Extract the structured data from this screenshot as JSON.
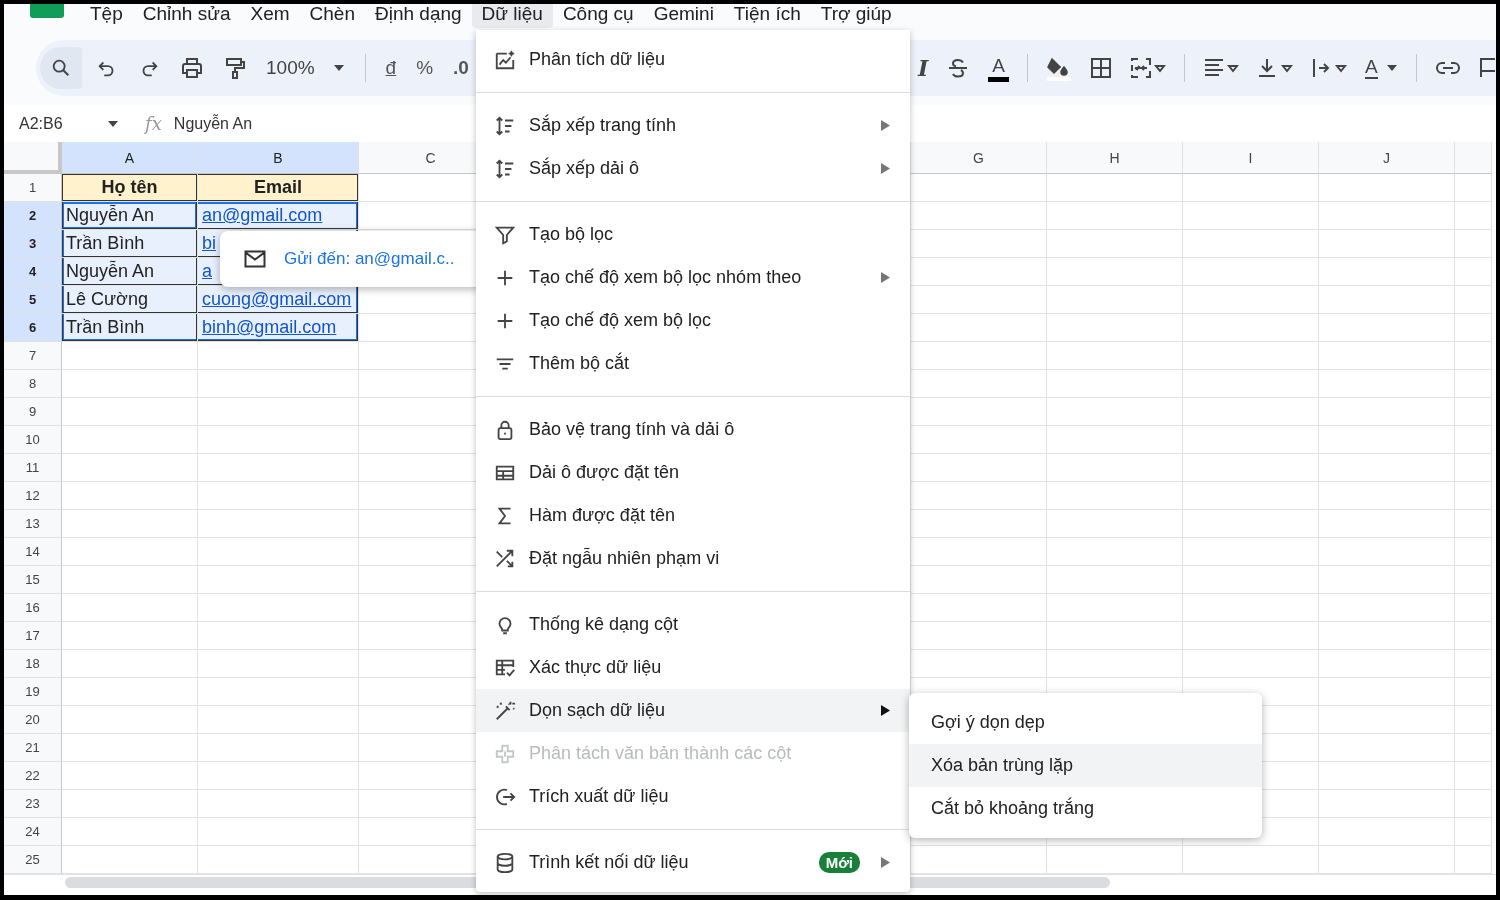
{
  "menu_bar": {
    "items": [
      {
        "label": "Tệp",
        "selected": false
      },
      {
        "label": "Chỉnh sửa",
        "selected": false
      },
      {
        "label": "Xem",
        "selected": false
      },
      {
        "label": "Chèn",
        "selected": false
      },
      {
        "label": "Định dạng",
        "selected": false
      },
      {
        "label": "Dữ liệu",
        "selected": true
      },
      {
        "label": "Công cụ",
        "selected": false
      },
      {
        "label": "Gemini",
        "selected": false
      },
      {
        "label": "Tiện ích",
        "selected": false
      },
      {
        "label": "Trợ giúp",
        "selected": false
      }
    ]
  },
  "toolbar": {
    "zoom": "100%",
    "currency": "đ",
    "percent": "%",
    "decimal": ".0",
    "italic": "I",
    "text_color": "A",
    "text_rotation": "A"
  },
  "formula_bar": {
    "name_box": "A2:B6",
    "fx": "fx",
    "value": "Nguyễn An"
  },
  "sheet": {
    "columns": [
      {
        "label": "A",
        "selected": true
      },
      {
        "label": "B",
        "selected": true
      },
      {
        "label": "C",
        "selected": false
      },
      {
        "label": "G",
        "selected": false
      },
      {
        "label": "H",
        "selected": false
      },
      {
        "label": "I",
        "selected": false
      },
      {
        "label": "J",
        "selected": false
      }
    ],
    "rows": [
      {
        "number": "1",
        "selected": false,
        "kind": "header",
        "cells": [
          {
            "text": "Họ tên",
            "link": false,
            "active": false
          },
          {
            "text": "Email",
            "link": false,
            "active": false
          }
        ]
      },
      {
        "number": "2",
        "selected": true,
        "kind": "data",
        "cells": [
          {
            "text": "Nguyễn An",
            "link": false,
            "active": true
          },
          {
            "text": "an@gmail.com",
            "link": true,
            "active": false
          }
        ]
      },
      {
        "number": "3",
        "selected": true,
        "kind": "data",
        "cells": [
          {
            "text": "Trần Bình",
            "link": false,
            "active": false
          },
          {
            "text": "bi",
            "link": true,
            "active": false
          }
        ]
      },
      {
        "number": "4",
        "selected": true,
        "kind": "data",
        "cells": [
          {
            "text": "Nguyễn An",
            "link": false,
            "active": false
          },
          {
            "text": "a",
            "link": true,
            "active": false
          }
        ]
      },
      {
        "number": "5",
        "selected": true,
        "kind": "data",
        "cells": [
          {
            "text": "Lê Cường",
            "link": false,
            "active": false
          },
          {
            "text": "cuong@gmail.com",
            "link": true,
            "active": false
          }
        ]
      },
      {
        "number": "6",
        "selected": true,
        "kind": "data",
        "cells": [
          {
            "text": "Trần Bình",
            "link": false,
            "active": false
          },
          {
            "text": "binh@gmail.com",
            "link": true,
            "active": false
          }
        ]
      },
      {
        "number": "7",
        "selected": false
      },
      {
        "number": "8",
        "selected": false
      },
      {
        "number": "9",
        "selected": false
      },
      {
        "number": "10",
        "selected": false
      },
      {
        "number": "11",
        "selected": false
      },
      {
        "number": "12",
        "selected": false
      },
      {
        "number": "13",
        "selected": false
      },
      {
        "number": "14",
        "selected": false
      },
      {
        "number": "15",
        "selected": false
      },
      {
        "number": "16",
        "selected": false
      },
      {
        "number": "17",
        "selected": false
      },
      {
        "number": "18",
        "selected": false
      },
      {
        "number": "19",
        "selected": false
      },
      {
        "number": "20",
        "selected": false
      },
      {
        "number": "21",
        "selected": false
      },
      {
        "number": "22",
        "selected": false
      },
      {
        "number": "23",
        "selected": false
      },
      {
        "number": "24",
        "selected": false
      },
      {
        "number": "25",
        "selected": false
      }
    ]
  },
  "link_tooltip": {
    "text": "Gửi đến: an@gmail.c.."
  },
  "data_menu": {
    "sections": [
      [
        {
          "label": "Phân tích dữ liệu",
          "submenu": false,
          "disabled": false,
          "selected": false
        }
      ],
      [
        {
          "label": "Sắp xếp trang tính",
          "submenu": true,
          "disabled": false,
          "selected": false
        },
        {
          "label": "Sắp xếp dải ô",
          "submenu": true,
          "disabled": false,
          "selected": false
        }
      ],
      [
        {
          "label": "Tạo bộ lọc",
          "submenu": false,
          "disabled": false,
          "selected": false
        },
        {
          "label": "Tạo chế độ xem bộ lọc nhóm theo",
          "submenu": true,
          "disabled": false,
          "selected": false
        },
        {
          "label": "Tạo chế độ xem bộ lọc",
          "submenu": false,
          "disabled": false,
          "selected": false
        },
        {
          "label": "Thêm bộ cắt",
          "submenu": false,
          "disabled": false,
          "selected": false
        }
      ],
      [
        {
          "label": "Bảo vệ trang tính và dải ô",
          "submenu": false,
          "disabled": false,
          "selected": false
        },
        {
          "label": "Dải ô được đặt tên",
          "submenu": false,
          "disabled": false,
          "selected": false
        },
        {
          "label": "Hàm được đặt tên",
          "submenu": false,
          "disabled": false,
          "selected": false
        },
        {
          "label": "Đặt ngẫu nhiên phạm vi",
          "submenu": false,
          "disabled": false,
          "selected": false
        }
      ],
      [
        {
          "label": "Thống kê dạng cột",
          "submenu": false,
          "disabled": false,
          "selected": false
        },
        {
          "label": "Xác thực dữ liệu",
          "submenu": false,
          "disabled": false,
          "selected": false
        },
        {
          "label": "Dọn sạch dữ liệu",
          "submenu": true,
          "disabled": false,
          "selected": true
        },
        {
          "label": "Phân tách văn bản thành các cột",
          "submenu": false,
          "disabled": true,
          "selected": false
        },
        {
          "label": "Trích xuất dữ liệu",
          "submenu": false,
          "disabled": false,
          "selected": false
        }
      ],
      [
        {
          "label": "Trình kết nối dữ liệu",
          "submenu": true,
          "disabled": false,
          "selected": false,
          "badge": "Mới"
        }
      ]
    ]
  },
  "submenu": {
    "items": [
      {
        "label": "Gợi ý dọn dẹp",
        "selected": false
      },
      {
        "label": "Xóa bản trùng lặp",
        "selected": true
      },
      {
        "label": "Cắt bỏ khoảng trắng",
        "selected": false
      }
    ]
  }
}
